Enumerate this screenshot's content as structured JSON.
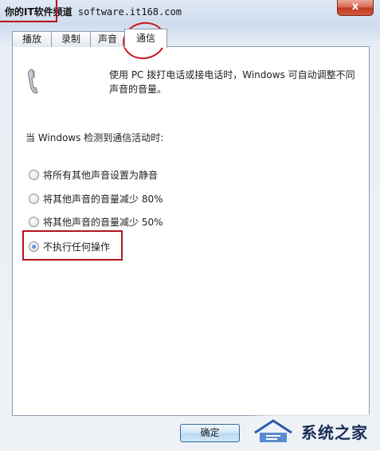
{
  "watermark": {
    "site_cn": "你的IT软件频道",
    "site_url": "software.it168.com"
  },
  "window": {
    "close_label": "x"
  },
  "tabs": [
    {
      "label": "播放",
      "active": false
    },
    {
      "label": "录制",
      "active": false
    },
    {
      "label": "声音",
      "active": false
    },
    {
      "label": "通信",
      "active": true
    }
  ],
  "communications": {
    "icon": "phone-handset-icon",
    "description": "使用 PC 拨打电话或接电话时，Windows 可自动调整不同声音的音量。",
    "prompt": "当 Windows 检测到通信活动时:",
    "options": [
      {
        "label": "将所有其他声音设置为静音",
        "selected": false
      },
      {
        "label": "将其他声音的音量减少 80%",
        "selected": false
      },
      {
        "label": "将其他声音的音量减少 50%",
        "selected": false
      },
      {
        "label": "不执行任何操作",
        "selected": true
      }
    ]
  },
  "buttons": {
    "ok_label": "确定"
  },
  "logo": {
    "text": "系统之家"
  },
  "colors": {
    "highlight": "#b4141b",
    "accent": "#1d5fb4"
  }
}
